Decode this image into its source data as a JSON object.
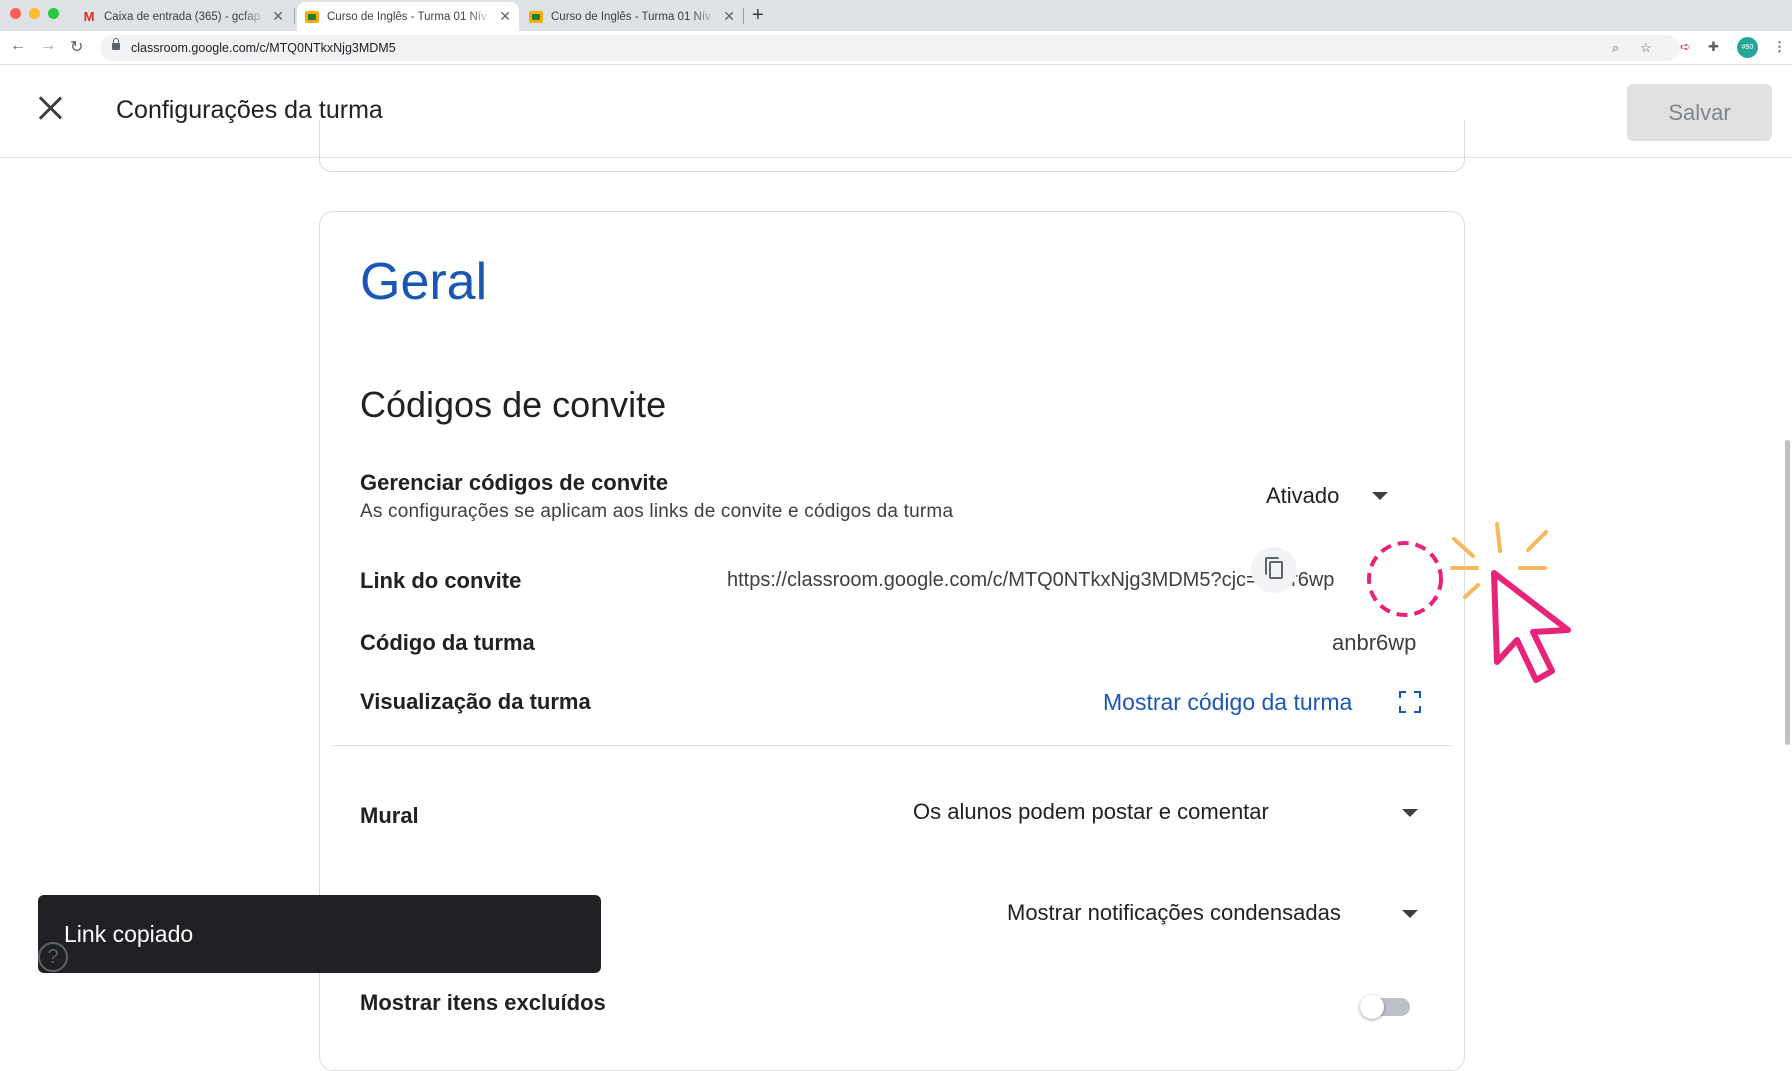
{
  "browser": {
    "tabs": [
      {
        "title": "Caixa de entrada (365) - gcfap",
        "icon": "gmail-icon",
        "active": false
      },
      {
        "title": "Curso de Inglês - Turma 01 Nív",
        "icon": "classroom-icon",
        "active": true
      },
      {
        "title": "Curso de Inglês - Turma 01 Nív",
        "icon": "classroom-icon",
        "active": false
      }
    ],
    "url": "classroom.google.com/c/MTQ0NTkxNjg3MDM5",
    "profile_label": "#90"
  },
  "header": {
    "title": "Configurações da turma",
    "save_label": "Salvar"
  },
  "general": {
    "section_title": "Geral",
    "invite_codes_title": "Códigos de convite",
    "manage": {
      "label": "Gerenciar códigos de convite",
      "description": "As configurações se aplicam aos links de convite e códigos da turma",
      "value": "Ativado"
    },
    "invite_link": {
      "label": "Link do convite",
      "value": "https://classroom.google.com/c/MTQ0NTkxNjg3MDM5?cjc=anbr6wp"
    },
    "class_code": {
      "label": "Código da turma",
      "value": "anbr6wp"
    },
    "class_view": {
      "label": "Visualização da turma",
      "link": "Mostrar código da turma"
    },
    "stream": {
      "label": "Mural",
      "value": "Os alunos podem postar e comentar"
    },
    "notifications": {
      "value": "Mostrar notificações condensadas"
    },
    "deleted_items": {
      "label": "Mostrar itens excluídos"
    }
  },
  "snackbar": {
    "text": "Link copiado"
  },
  "colors": {
    "accent_blue": "#1a57b5",
    "annotation_pink": "#e8247a",
    "annotation_orange": "#f6b85a"
  }
}
